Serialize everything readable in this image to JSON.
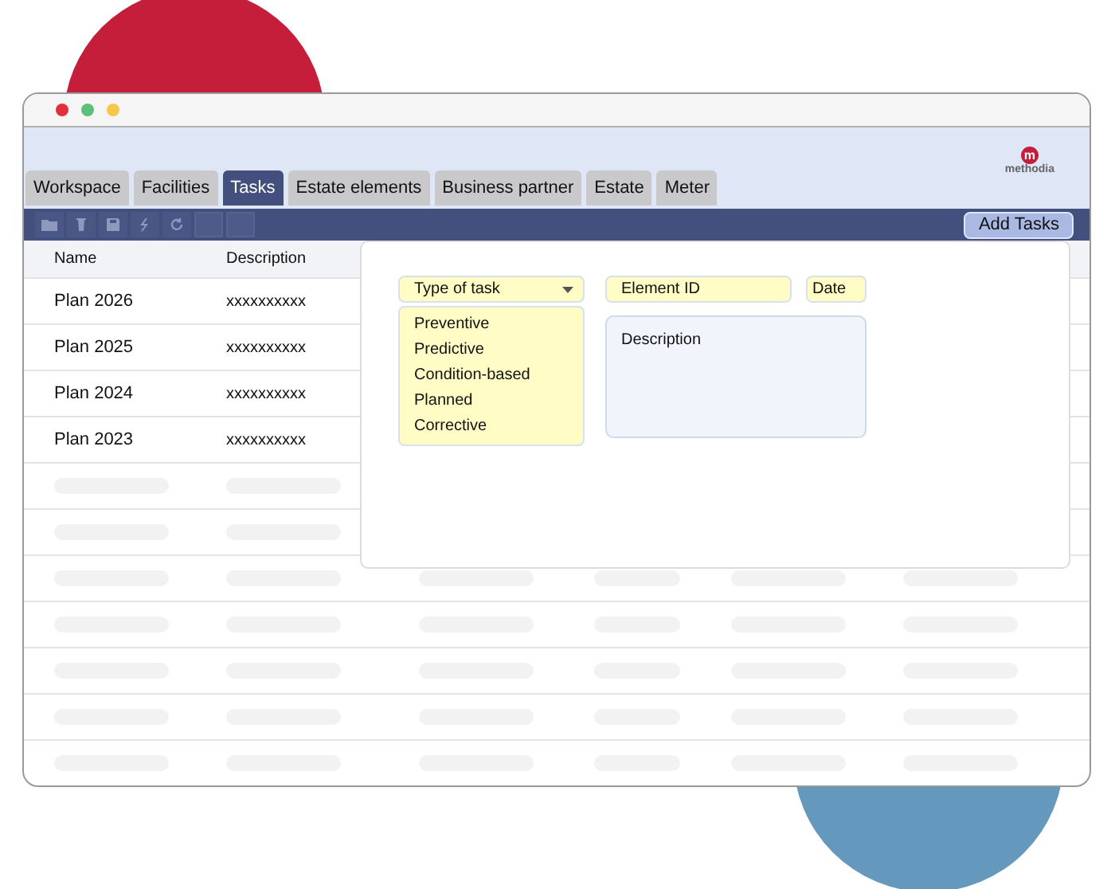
{
  "logo": {
    "mark": "m",
    "text": "methodia"
  },
  "tabs": [
    {
      "label": "Workspace",
      "selected": false
    },
    {
      "label": "Facilities",
      "selected": false
    },
    {
      "label": "Tasks",
      "selected": true
    },
    {
      "label": "Estate elements",
      "selected": false
    },
    {
      "label": "Business partner",
      "selected": false
    },
    {
      "label": "Estate",
      "selected": false
    },
    {
      "label": "Meter",
      "selected": false
    }
  ],
  "toolbar": {
    "add_button": "Add Tasks"
  },
  "table": {
    "columns": [
      "Name",
      "Description"
    ],
    "rows": [
      [
        "Plan 2026",
        "xxxxxxxxxx"
      ],
      [
        "Plan 2025",
        "xxxxxxxxxx"
      ],
      [
        "Plan 2024",
        "xxxxxxxxxx"
      ],
      [
        "Plan 2023",
        "xxxxxxxxxx"
      ]
    ]
  },
  "task_form": {
    "type_dropdown": {
      "label": "Type of task",
      "expanded": true,
      "options": [
        "Preventive",
        "Predictive",
        "Condition-based",
        "Planned",
        "Corrective"
      ]
    },
    "element_id": {
      "placeholder": "Element ID"
    },
    "date": {
      "placeholder": "Date"
    },
    "description": {
      "placeholder": "Description"
    }
  }
}
